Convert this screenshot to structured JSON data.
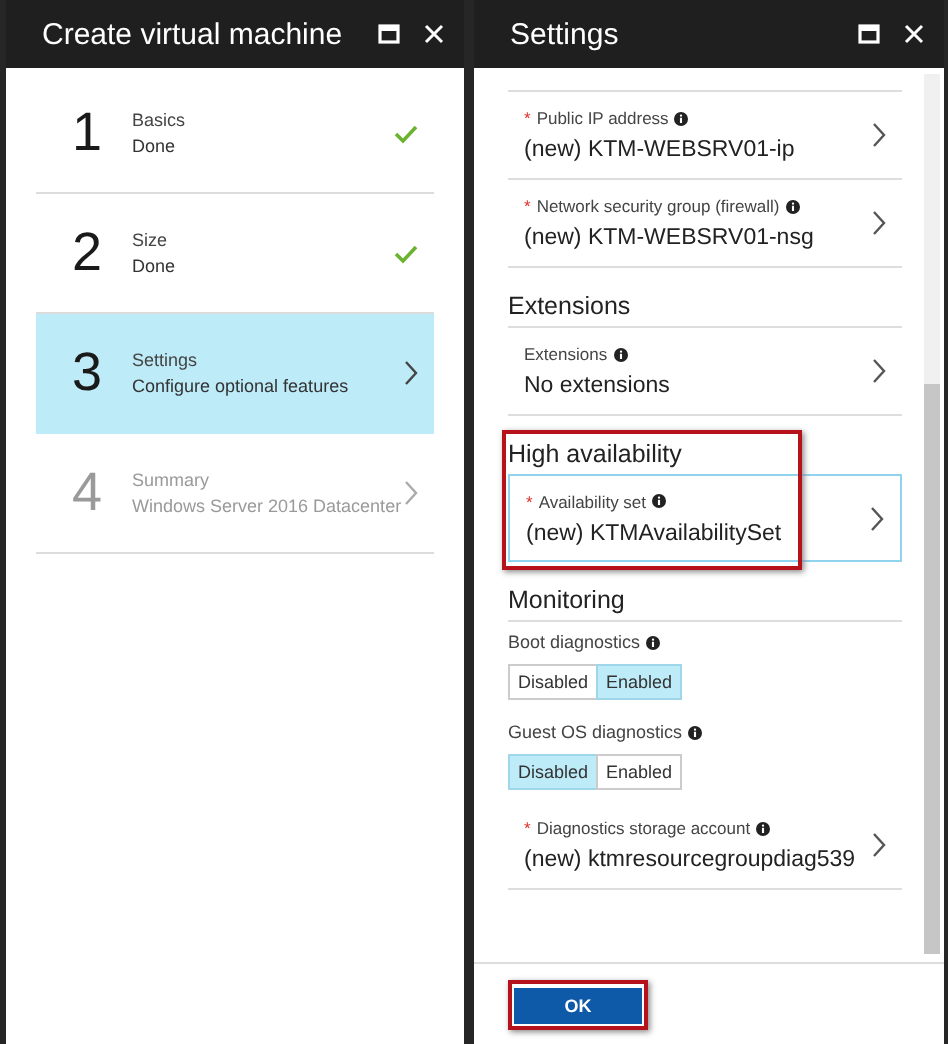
{
  "wizard": {
    "title": "Create virtual machine",
    "steps": [
      {
        "number": "1",
        "title": "Basics",
        "subtitle": "Done",
        "kind": "done",
        "selected": false,
        "disabled": false
      },
      {
        "number": "2",
        "title": "Size",
        "subtitle": "Done",
        "kind": "done",
        "selected": false,
        "disabled": false
      },
      {
        "number": "3",
        "title": "Settings",
        "subtitle": "Configure optional features",
        "kind": "chevron",
        "selected": true,
        "disabled": false
      },
      {
        "number": "4",
        "title": "Summary",
        "subtitle": "Windows Server 2016 Datacenter",
        "kind": "chevron",
        "selected": false,
        "disabled": true
      }
    ]
  },
  "settings": {
    "title": "Settings",
    "sections": [
      {
        "highlighted": false,
        "items": [
          {
            "kind": "field",
            "label": "Public IP address",
            "required": "*",
            "info": true,
            "value": "(new) KTM-WEBSRV01-ip",
            "focused": false
          },
          {
            "kind": "field",
            "label": "Network security group (firewall)",
            "required": "*",
            "info": true,
            "value": "(new) KTM-WEBSRV01-nsg",
            "focused": false
          }
        ]
      },
      {
        "heading": "Extensions",
        "highlighted": false,
        "items": [
          {
            "kind": "field",
            "label": "Extensions",
            "info": true,
            "value": "No extensions",
            "focused": false
          }
        ]
      },
      {
        "heading": "High availability",
        "highlighted": true,
        "items": [
          {
            "kind": "field",
            "label": "Availability set",
            "required": "*",
            "info": true,
            "value": "(new) KTMAvailabilitySet",
            "focused": true
          }
        ]
      },
      {
        "heading": "Monitoring",
        "highlighted": false,
        "items": [
          {
            "kind": "toggle",
            "label": "Boot diagnostics",
            "info": true,
            "options": [
              {
                "label": "Disabled",
                "selected": false
              },
              {
                "label": "Enabled",
                "selected": true
              }
            ]
          },
          {
            "kind": "toggle",
            "label": "Guest OS diagnostics",
            "info": true,
            "options": [
              {
                "label": "Disabled",
                "selected": true
              },
              {
                "label": "Enabled",
                "selected": false
              }
            ]
          },
          {
            "kind": "field",
            "label": "Diagnostics storage account",
            "required": "*",
            "info": true,
            "value": "(new) ktmresourcegroupdiag539",
            "focused": false
          }
        ]
      }
    ],
    "ok_button": {
      "label": "OK",
      "highlighted": true
    }
  }
}
